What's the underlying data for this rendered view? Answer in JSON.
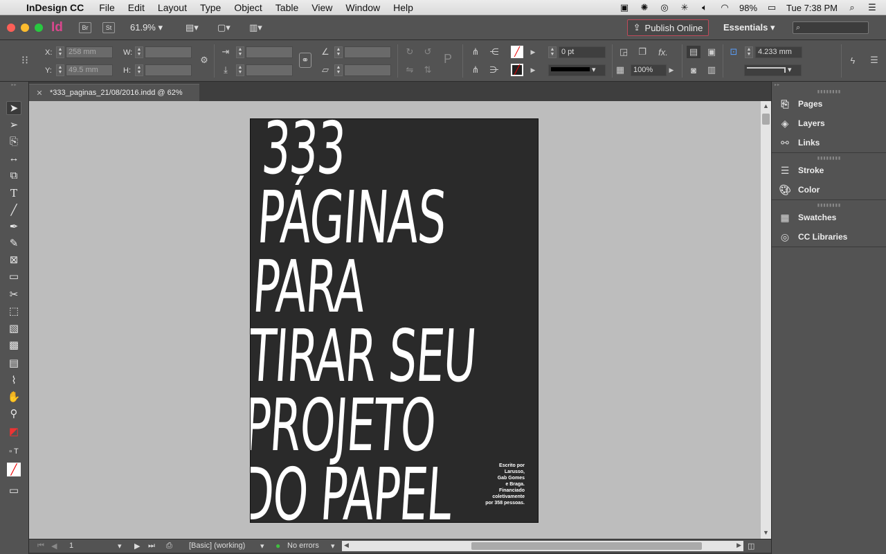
{
  "menubar": {
    "app_name": "InDesign CC",
    "items": [
      "File",
      "Edit",
      "Layout",
      "Type",
      "Object",
      "Table",
      "View",
      "Window",
      "Help"
    ],
    "battery": "98%",
    "clock": "Tue 7:38 PM"
  },
  "appbar": {
    "logo": "Id",
    "bridge_label": "Br",
    "stock_label": "St",
    "zoom_value": "61.9%",
    "publish_label": "Publish Online",
    "workspace_label": "Essentials"
  },
  "control": {
    "x_label": "X:",
    "x_value": "258 mm",
    "y_label": "Y:",
    "y_value": "49.5 mm",
    "w_label": "W:",
    "h_label": "H:",
    "stroke_weight": "0 pt",
    "opacity": "100%",
    "fit_size": "4.233 mm"
  },
  "document": {
    "tab_title": "*333_paginas_21/08/2016.indd @ 62%",
    "headline": "333\nPÁGINAS\nPARA\nTIRAR SEU\nPROJETO\nDO PAPEL",
    "credits": "Escrito por\nLarusso,\nGab Gomes\ne Braga.\nFinanciado\ncoletivamente\npor 358 pessoas."
  },
  "status": {
    "page_number": "1",
    "preflight_profile": "[Basic] (working)",
    "errors": "No errors"
  },
  "panels": {
    "groups": [
      [
        {
          "label": "Pages",
          "icon": "pages-icon"
        },
        {
          "label": "Layers",
          "icon": "layers-icon"
        },
        {
          "label": "Links",
          "icon": "links-icon"
        }
      ],
      [
        {
          "label": "Stroke",
          "icon": "stroke-icon"
        },
        {
          "label": "Color",
          "icon": "color-icon"
        }
      ],
      [
        {
          "label": "Swatches",
          "icon": "swatches-icon"
        },
        {
          "label": "CC Libraries",
          "icon": "cc-libraries-icon"
        }
      ]
    ]
  },
  "colors": {
    "page_bg": "#2a2a2a",
    "pasteboard": "#bdbdbd",
    "ui_panel": "#535353",
    "publish_border": "#c04a5a",
    "id_brand": "#d9478d"
  }
}
